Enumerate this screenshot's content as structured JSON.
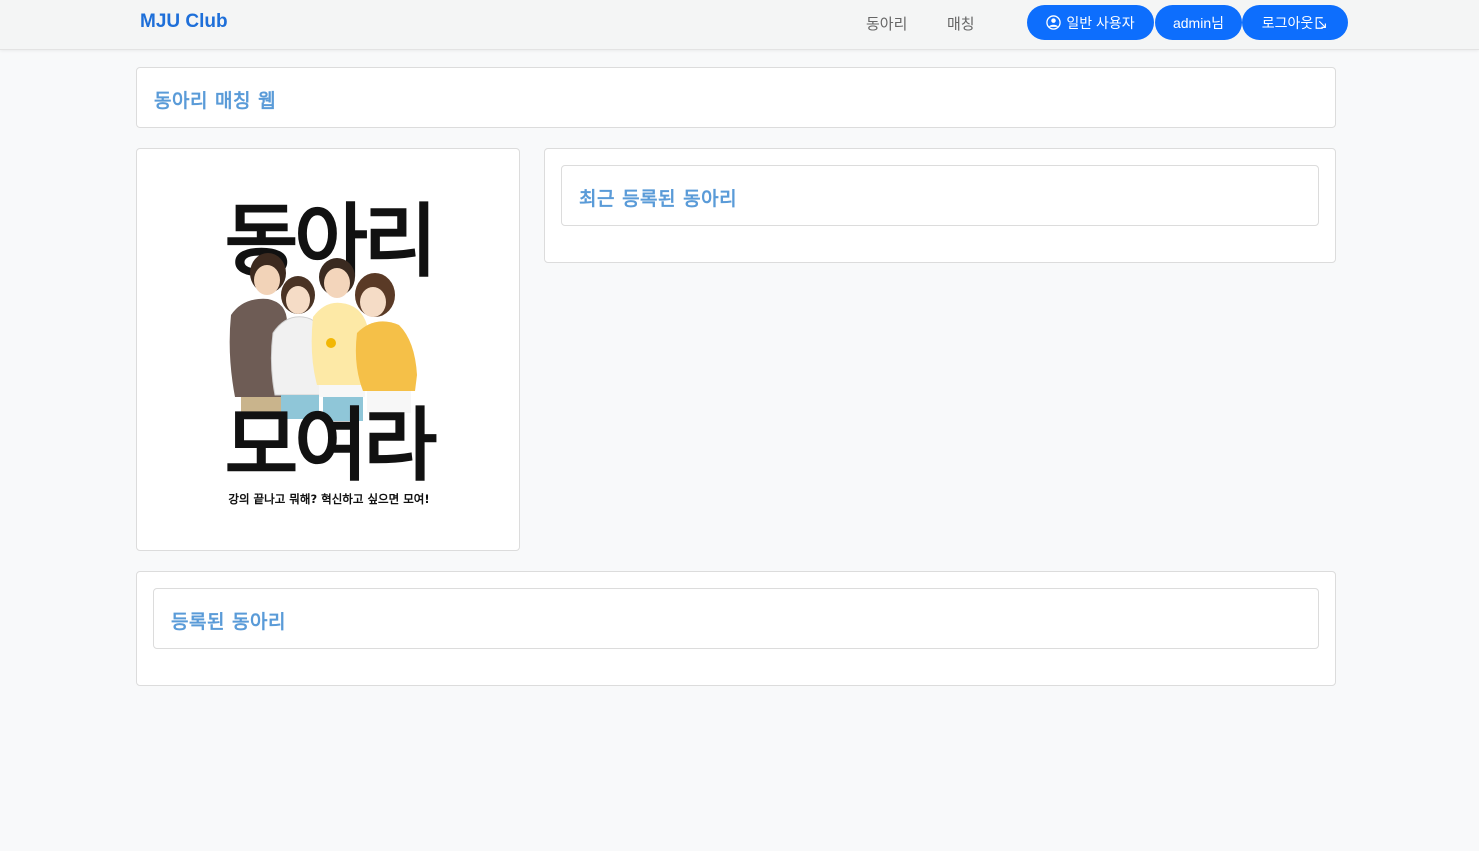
{
  "navbar": {
    "brand": "MJU Club",
    "links": [
      "동아리",
      "매칭"
    ],
    "role_button": "일반 사용자",
    "user_button": "admin님",
    "logout_button": "로그아웃",
    "accent_color": "#0d6efd",
    "brand_color": "#1e6fd9"
  },
  "header": {
    "title": "동아리 매칭 웹"
  },
  "poster": {
    "headline_top": "동아리",
    "headline_bottom": "모여라",
    "tagline": "강의 끝나고 뭐해? 혁신하고 싶으면 모여!",
    "illustration": "four-students-looking-at-phone"
  },
  "recent": {
    "title": "최근 등록된 동아리"
  },
  "registered": {
    "title": "등록된 동아리"
  },
  "icons": {
    "role": "person-circle-icon",
    "logout": "box-arrow-right-icon"
  }
}
